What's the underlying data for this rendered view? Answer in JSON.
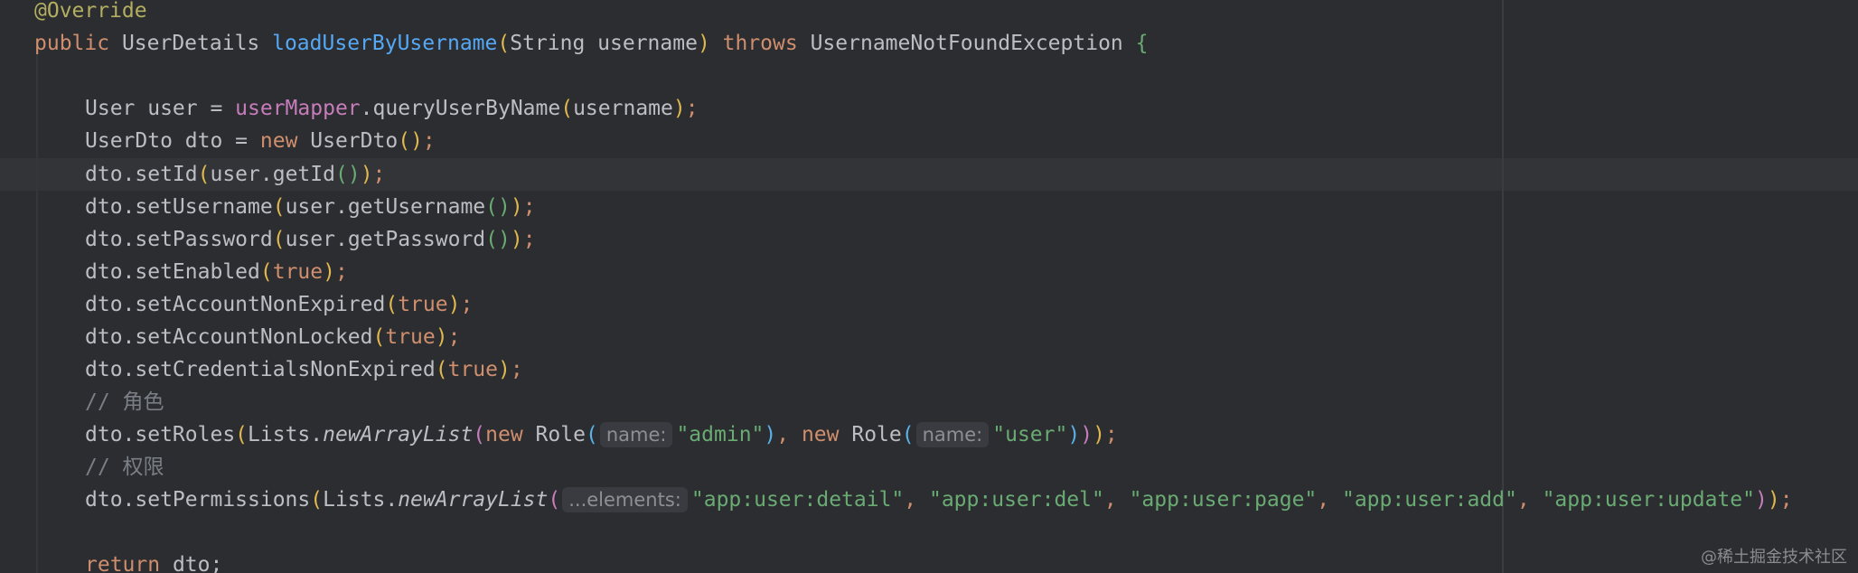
{
  "editor": {
    "colors": {
      "background": "#2b2d30",
      "text": "#bcbec4",
      "keyword": "#cf8e6d",
      "annotation": "#b3ae60",
      "method_declaration": "#56a8f5",
      "field": "#c77dbb",
      "string": "#6aab73",
      "comment": "#7a7e85",
      "inlay_hint_bg": "#393b40"
    },
    "annotation": "@Override",
    "sig": {
      "public": "public",
      "ret": " UserDetails ",
      "method": "loadUserByUsername",
      "open": "(",
      "params": "String username",
      "close": ")",
      "throws": " throws ",
      "exc": "UsernameNotFoundException ",
      "brace": "{"
    },
    "l3": {
      "a": "User user = ",
      "field": "userMapper",
      "b": ".queryUserByName",
      "open": "(",
      "arg": "username",
      "close": ")",
      "semi": ";"
    },
    "l4": {
      "a": "UserDto dto = ",
      "new": "new",
      "b": " UserDto",
      "open": "(",
      "close": ")",
      "semi": ";"
    },
    "l5": {
      "a": "dto.setId",
      "open": "(",
      "b": "user.getId",
      "open2": "(",
      "close2": ")",
      "close": ")",
      "semi": ";"
    },
    "l6": {
      "a": "dto.setUsername",
      "open": "(",
      "b": "user.getUsername",
      "open2": "(",
      "close2": ")",
      "close": ")",
      "semi": ";"
    },
    "l7": {
      "a": "dto.setPassword",
      "open": "(",
      "b": "user.getPassword",
      "open2": "(",
      "close2": ")",
      "close": ")",
      "semi": ";"
    },
    "l8": {
      "a": "dto.setEnabled",
      "open": "(",
      "val": "true",
      "close": ")",
      "semi": ";"
    },
    "l9": {
      "a": "dto.setAccountNonExpired",
      "open": "(",
      "val": "true",
      "close": ")",
      "semi": ";"
    },
    "l10": {
      "a": "dto.setAccountNonLocked",
      "open": "(",
      "val": "true",
      "close": ")",
      "semi": ";"
    },
    "l11": {
      "a": "dto.setCredentialsNonExpired",
      "open": "(",
      "val": "true",
      "close": ")",
      "semi": ";"
    },
    "comment_roles": "// 角色",
    "l13": {
      "a": "dto.setRoles",
      "open1": "(",
      "b": "Lists.",
      "c": "newArrayList",
      "open2": "(",
      "new1": "new",
      "d": " Role",
      "open3": "(",
      "hint1": "name:",
      "s1": "\"admin\"",
      "close3": ")",
      "comma": ", ",
      "new2": "new",
      "e": " Role",
      "open4": "(",
      "hint2": "name:",
      "s2": "\"user\"",
      "close4": ")",
      "close2": ")",
      "close1": ")",
      "semi": ";"
    },
    "comment_perms": "// 权限",
    "l15": {
      "a": "dto.setPermissions",
      "open1": "(",
      "b": "Lists.",
      "c": "newArrayList",
      "open2": "(",
      "hint": "...elements:",
      "s1": "\"app:user:detail\"",
      "c1": ", ",
      "s2": "\"app:user:del\"",
      "c2": ", ",
      "s3": "\"app:user:page\"",
      "c3": ", ",
      "s4": "\"app:user:add\"",
      "c4": ", ",
      "s5": "\"app:user:update\"",
      "close2": ")",
      "close1": ")",
      "semi": ";"
    },
    "l17": {
      "ret": "return",
      "a": " dto;"
    }
  },
  "watermark": "@稀土掘金技术社区"
}
